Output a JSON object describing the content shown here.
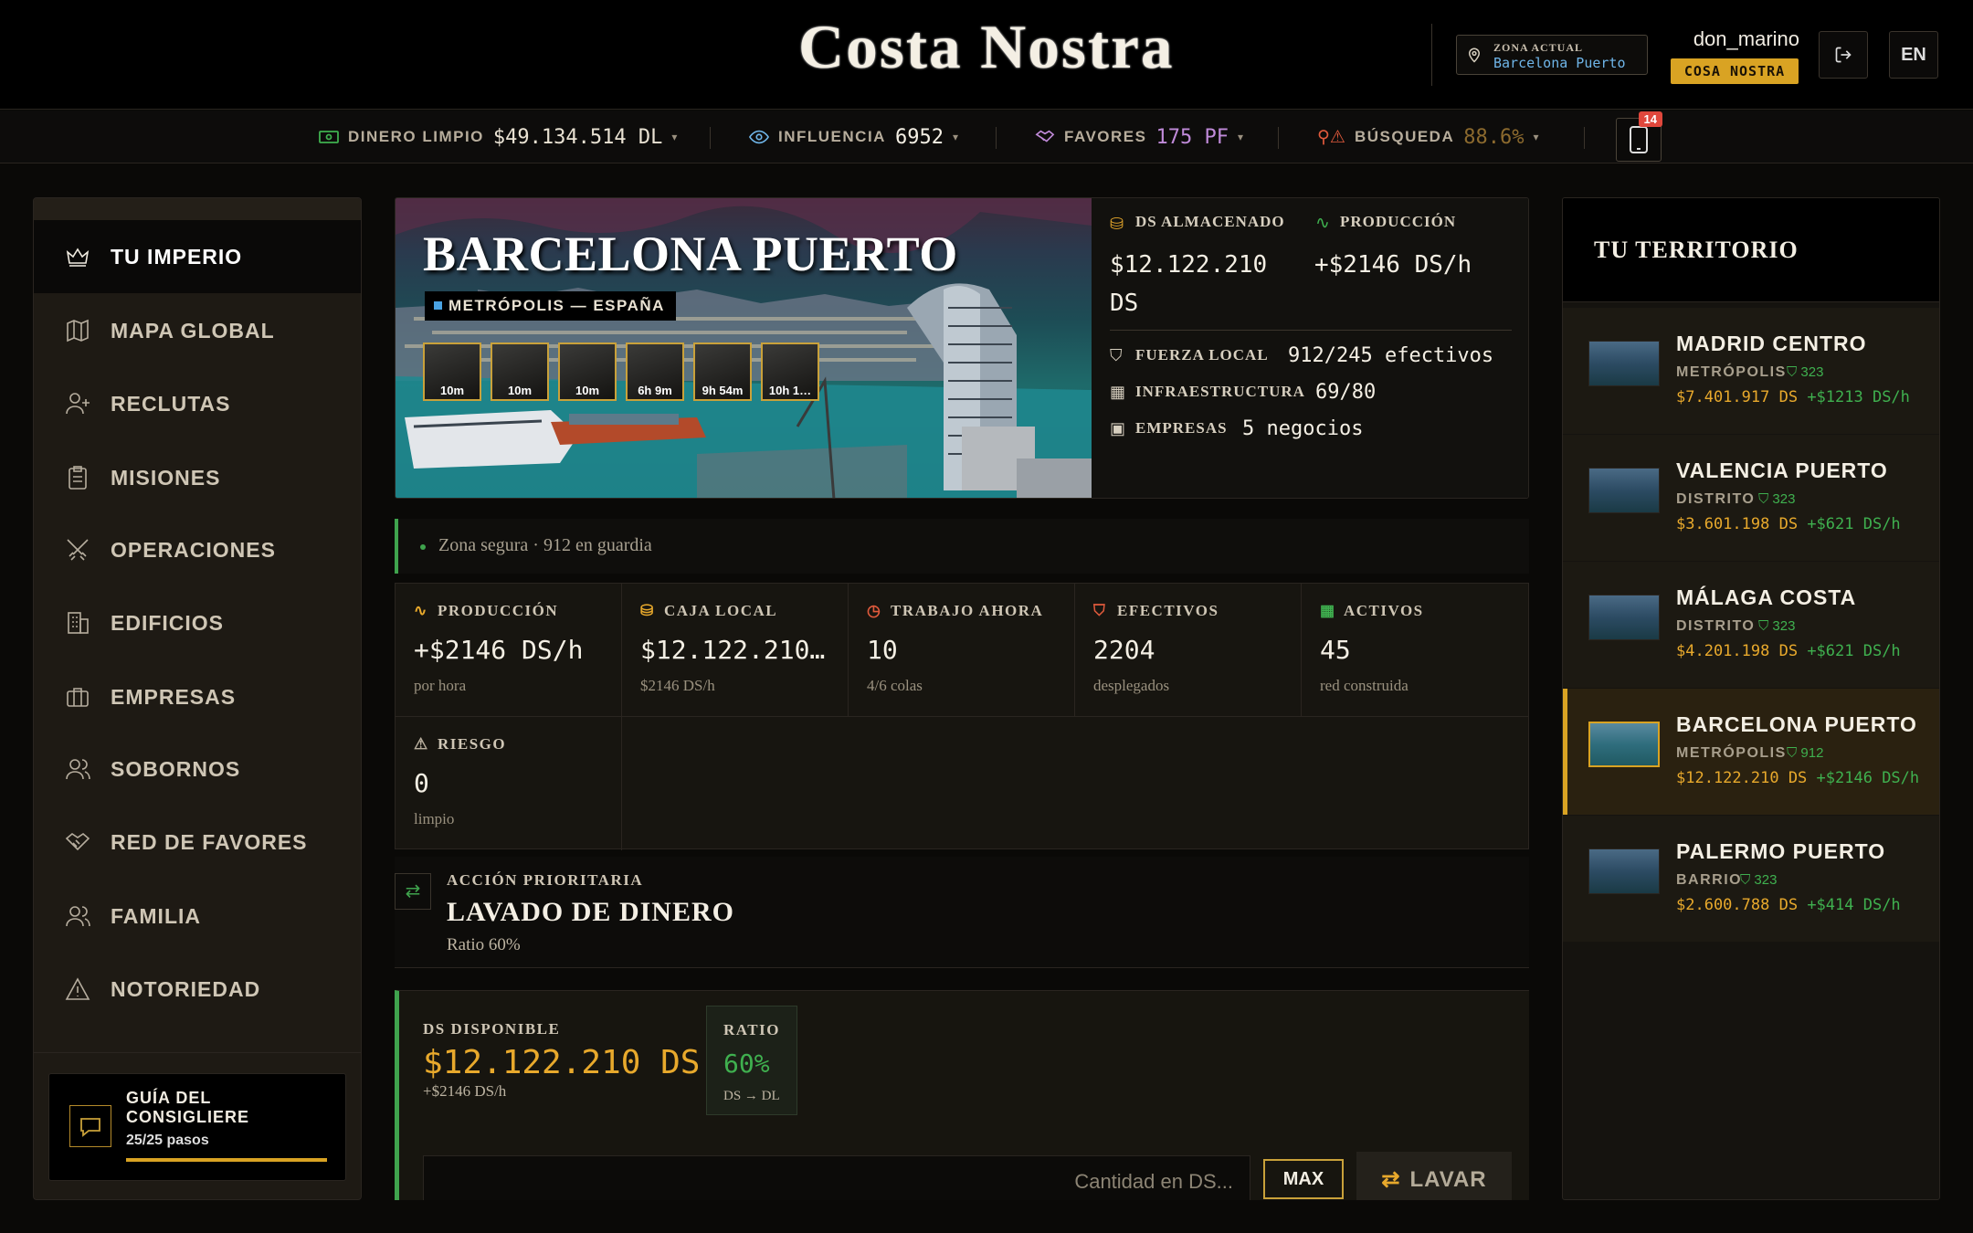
{
  "header": {
    "logo": "Costa Nostra",
    "zone_label": "ZONA ACTUAL",
    "zone_value": "Barcelona Puerto",
    "username": "don_marino",
    "faction_badge": "COSA NOSTRA",
    "language": "EN"
  },
  "stats": {
    "clean_money": {
      "label": "DINERO LIMPIO",
      "value": "$49.134.514 DL"
    },
    "influence": {
      "label": "INFLUENCIA",
      "value": "6952"
    },
    "favors": {
      "label": "FAVORES",
      "value": "175 PF"
    },
    "search": {
      "label": "BÚSQUEDA",
      "value": "88.6%"
    },
    "phone_notifications": "14"
  },
  "colors": {
    "accent": "#d9a323",
    "green": "#3fb04f",
    "blue": "#6fb5e8",
    "purple": "#c08ad9",
    "red": "#e0473c"
  },
  "sidebar": {
    "items": [
      {
        "label": "TU IMPERIO",
        "icon": "crown-icon"
      },
      {
        "label": "MAPA GLOBAL",
        "icon": "map-icon"
      },
      {
        "label": "RECLUTAS",
        "icon": "user-plus-icon"
      },
      {
        "label": "MISIONES",
        "icon": "clipboard-icon"
      },
      {
        "label": "OPERACIONES",
        "icon": "swords-icon"
      },
      {
        "label": "EDIFICIOS",
        "icon": "building-icon"
      },
      {
        "label": "EMPRESAS",
        "icon": "briefcase-icon"
      },
      {
        "label": "SOBORNOS",
        "icon": "users-icon"
      },
      {
        "label": "RED DE FAVORES",
        "icon": "handshake-icon"
      },
      {
        "label": "FAMILIA",
        "icon": "family-icon"
      },
      {
        "label": "NOTORIEDAD",
        "icon": "alert-triangle-icon"
      }
    ],
    "guide": {
      "title": "GUÍA DEL CONSIGLIERE",
      "progress": "25/25 pasos",
      "progress_fraction": 1.0
    }
  },
  "city": {
    "name": "BARCELONA PUERTO",
    "tag": "METRÓPOLIS — ESPAÑA",
    "timers": [
      "10m",
      "10m",
      "10m",
      "6h 9m",
      "9h 54m",
      "10h 1…"
    ],
    "stored_label": "DS ALMACENADO",
    "stored_value": "$12.122.210 DS",
    "production_label": "PRODUCCIÓN",
    "production_value": "+$2146 DS/h",
    "force_label": "FUERZA LOCAL",
    "force_value": "912/245 efectivos",
    "infra_label": "INFRAESTRUCTURA",
    "infra_value": "69/80",
    "companies_label": "EMPRESAS",
    "companies_value": "5 negocios",
    "status": "Zona segura · 912 en guardia"
  },
  "metrics": [
    {
      "label": "PRODUCCIÓN",
      "value": "+$2146 DS/h",
      "sub": "por hora"
    },
    {
      "label": "CAJA LOCAL",
      "value": "$12.122.210…",
      "sub": "$2146 DS/h"
    },
    {
      "label": "TRABAJO AHORA",
      "value": "10",
      "sub": "4/6 colas"
    },
    {
      "label": "EFECTIVOS",
      "value": "2204",
      "sub": "desplegados"
    },
    {
      "label": "ACTIVOS",
      "value": "45",
      "sub": "red construida"
    },
    {
      "label": "RIESGO",
      "value": "0",
      "sub": "limpio"
    }
  ],
  "priority": {
    "label": "ACCIÓN PRIORITARIA",
    "title": "LAVADO DE DINERO",
    "ratio": "Ratio 60%"
  },
  "wash": {
    "available_label": "DS DISPONIBLE",
    "available_value": "$12.122.210 DS",
    "available_rate": "+$2146 DS/h",
    "ratio_label": "RATIO",
    "ratio_value": "60%",
    "ratio_conv": "DS → DL",
    "input_placeholder": "Cantidad en DS...",
    "max_label": "MAX",
    "button_label": "LAVAR"
  },
  "territory": {
    "title": "TU TERRITORIO",
    "items": [
      {
        "name": "MADRID CENTRO",
        "type": "METRÓPOLIS",
        "guards": "323",
        "money": "$7.401.917 DS",
        "rate": "+$1213 DS/h",
        "selected": false
      },
      {
        "name": "VALENCIA PUERTO",
        "type": "DISTRITO",
        "guards": "323",
        "money": "$3.601.198 DS",
        "rate": "+$621 DS/h",
        "selected": false
      },
      {
        "name": "MÁLAGA COSTA",
        "type": "DISTRITO",
        "guards": "323",
        "money": "$4.201.198 DS",
        "rate": "+$621 DS/h",
        "selected": false
      },
      {
        "name": "BARCELONA PUERTO",
        "type": "METRÓPOLIS",
        "guards": "912",
        "money": "$12.122.210 DS",
        "rate": "+$2146 DS/h",
        "selected": true
      },
      {
        "name": "PALERMO PUERTO",
        "type": "BARRIO",
        "guards": "323",
        "money": "$2.600.788 DS",
        "rate": "+$414 DS/h",
        "selected": false
      }
    ]
  }
}
